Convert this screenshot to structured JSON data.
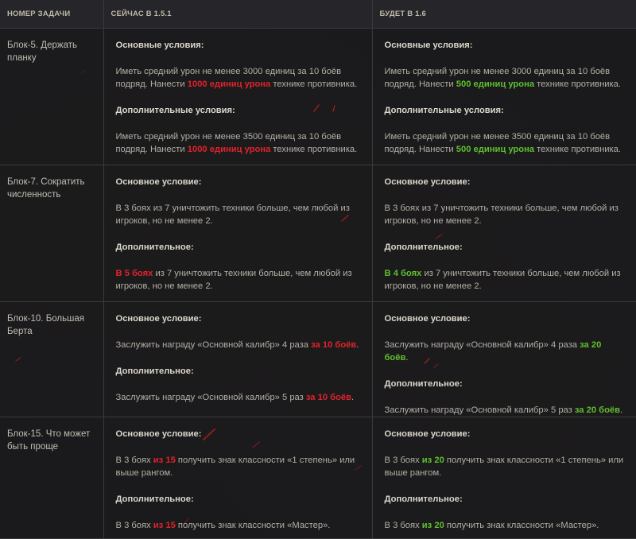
{
  "header": {
    "col1": "НОМЕР ЗАДАЧИ",
    "col2": "СЕЙЧАС В 1.5.1",
    "col3": "БУДЕТ В 1.6"
  },
  "colors": {
    "old_highlight": "#e0232b",
    "new_highlight": "#5fbf2f"
  },
  "rows": [
    {
      "task": "Блок-5. Держать планку",
      "old": {
        "main_label": "Основные условия:",
        "main_pre": "Иметь средний урон не менее 3000 единиц за 10 боёв подряд. Нанести ",
        "main_hl": "1000 единиц урона",
        "main_post": " технике противника.",
        "extra_label": "Дополнительные условия:",
        "extra_pre": "Иметь средний урон не менее 3500 единиц за 10 боёв подряд. Нанести ",
        "extra_hl": "1000 единиц урона",
        "extra_post": " технике противника."
      },
      "new": {
        "main_label": "Основные условия:",
        "main_pre": "Иметь средний урон не менее 3000 единиц за 10 боёв подряд. Нанести ",
        "main_hl": "500 единиц урона",
        "main_post": " технике противника.",
        "extra_label": "Дополнительные условия:",
        "extra_pre": "Иметь средний урон не менее 3500 единиц за 10 боёв подряд. Нанести ",
        "extra_hl": "500 единиц урона",
        "extra_post": " технике противника."
      }
    },
    {
      "task": "Блок-7. Сократить численность",
      "old": {
        "main_label": "Основное условие:",
        "main_text": "В 3 боях из 7 уничтожить техники больше, чем любой из игроков, но не менее 2.",
        "extra_label": "Дополнительное:",
        "extra_pre": "",
        "extra_hl": "В 5 боях",
        "extra_post": " из 7 уничтожить техники больше, чем любой из игроков, но не менее 2."
      },
      "new": {
        "main_label": "Основное условие:",
        "main_text": "В 3 боях из 7 уничтожить техники больше, чем любой из игроков, но не менее 2.",
        "extra_label": "Дополнительное:",
        "extra_pre": "",
        "extra_hl": "В 4 боях",
        "extra_post": " из 7 уничтожить техники больше, чем любой из игроков, но не менее 2."
      }
    },
    {
      "task": "Блок-10. Большая Берта",
      "old": {
        "main_label": "Основное условие:",
        "main_pre": "Заслужить награду «Основной калибр» 4 раза ",
        "main_hl": "за 10 боёв",
        "main_post": ".",
        "extra_label": "Дополнительное:",
        "extra_pre": "Заслужить награду «Основной калибр» 5 раз ",
        "extra_hl": "за 10 боёв",
        "extra_post": "."
      },
      "new": {
        "main_label": "Основное условие:",
        "main_pre": "Заслужить награду «Основной калибр» 4 раза ",
        "main_hl": "за 20 боёв",
        "main_post": ".",
        "extra_label": "Дополнительное:",
        "extra_pre": "Заслужить награду «Основной калибр» 5 раз ",
        "extra_hl": "за 20 боёв",
        "extra_post": "."
      }
    },
    {
      "task": "Блок-15. Что может быть проще",
      "old": {
        "main_label": "Основное условие:",
        "main_pre": "В 3 боях ",
        "main_hl": "из 15",
        "main_post": " получить знак классности «1 степень» или выше рангом.",
        "extra_label": "Дополнительное:",
        "extra_pre": "В 3 боях ",
        "extra_hl": "из 15",
        "extra_post": " получить знак классности «Мастер»."
      },
      "new": {
        "main_label": "Основное условие:",
        "main_pre": "В 3 боях ",
        "main_hl": "из 20",
        "main_post": " получить знак классности «1 степень» или выше рангом.",
        "extra_label": "Дополнительное:",
        "extra_pre": "В 3 боях ",
        "extra_hl": "из 20",
        "extra_post": " получить знак классности «Мастер»."
      }
    }
  ]
}
